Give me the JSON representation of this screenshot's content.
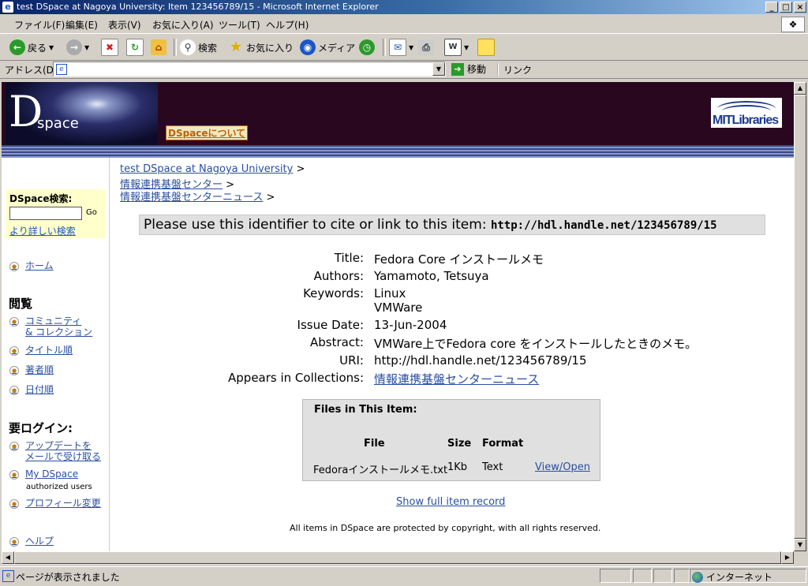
{
  "window": {
    "title": "test DSpace at Nagoya University: Item 123456789/15 - Microsoft Internet Explorer"
  },
  "menu": [
    "ファイル(F)",
    "編集(E)",
    "表示(V)",
    "お気に入り(A)",
    "ツール(T)",
    "ヘルプ(H)"
  ],
  "toolbar": {
    "back": "戻る",
    "search": "検索",
    "favorites": "お気に入り",
    "media": "メディア"
  },
  "address": {
    "label": "アドレス(D)",
    "value": "",
    "go": "移動",
    "links": "リンク"
  },
  "status": {
    "text": "ページが表示されました",
    "zone": "インターネット"
  },
  "header": {
    "logo_d": "D",
    "logo_space": "space",
    "about": "DSpaceについて",
    "mit": "MITLibraries"
  },
  "sidebar": {
    "search_label": "DSpace検索:",
    "go": "Go",
    "advanced": "より詳しい検索",
    "home": "ホーム",
    "browse_head": "閲覧",
    "communities_1": "コミュニティ",
    "communities_2": "& コレクション",
    "by_title": "タイトル順",
    "by_author": "著者順",
    "by_date": "日付順",
    "login_head": "要ログイン:",
    "subscribe_1": "アップデートを",
    "subscribe_2": "メールで受け取る",
    "mydspace": "My DSpace",
    "authorized": "authorized users",
    "profile": "プロフィール変更",
    "help": "ヘルプ"
  },
  "breadcrumb": [
    {
      "label": "test DSpace at Nagoya University",
      "sep": " >"
    },
    {
      "label": "情報連携基盤センター",
      "sep": " >"
    },
    {
      "label": "情報連携基盤センターニュース",
      "sep": " >"
    }
  ],
  "cite": {
    "text": "Please use this identifier to cite or link to this item:",
    "url": "http://hdl.handle.net/123456789/15"
  },
  "item": {
    "title_label": "Title:",
    "title": "Fedora Core インストールメモ",
    "authors_label": "Authors:",
    "authors": "Yamamoto, Tetsuya",
    "keywords_label": "Keywords:",
    "keyword1": "Linux",
    "keyword2": "VMWare",
    "date_label": "Issue Date:",
    "date": "13-Jun-2004",
    "abstract_label": "Abstract:",
    "abstract": "VMWare上でFedora core をインストールしたときのメモ。",
    "uri_label": "URI:",
    "uri": "http://hdl.handle.net/123456789/15",
    "collections_label": "Appears in Collections:",
    "collection": "情報連携基盤センターニュース"
  },
  "files": {
    "title": "Files in This Item:",
    "headers": [
      "File",
      "Size",
      "Format"
    ],
    "row": {
      "file": "Fedoraインストールメモ.txt",
      "size": "1Kb",
      "format": "Text",
      "action": "View/Open"
    }
  },
  "show_full": "Show full item record",
  "footer": "All items in DSpace are protected by copyright, with all rights reserved."
}
